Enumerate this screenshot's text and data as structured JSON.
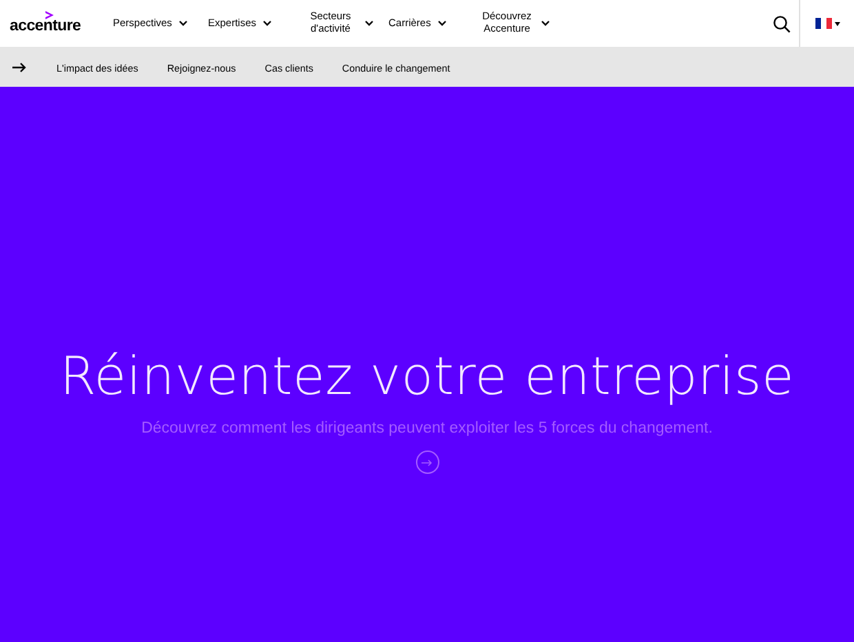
{
  "logo": "accenture",
  "nav": [
    {
      "label": "Perspectives"
    },
    {
      "label": "Expertises"
    },
    {
      "label": "Secteurs d'activité"
    },
    {
      "label": "Carrières"
    },
    {
      "label": "Découvrez Accenture"
    }
  ],
  "subnav": [
    "L'impact des idées",
    "Rejoignez-nous",
    "Cas clients",
    "Conduire le changement"
  ],
  "hero": {
    "title": "Réinventez votre entreprise",
    "subtitle": "Découvrez comment les dirigeants peuvent exploiter les 5 forces du changement."
  }
}
